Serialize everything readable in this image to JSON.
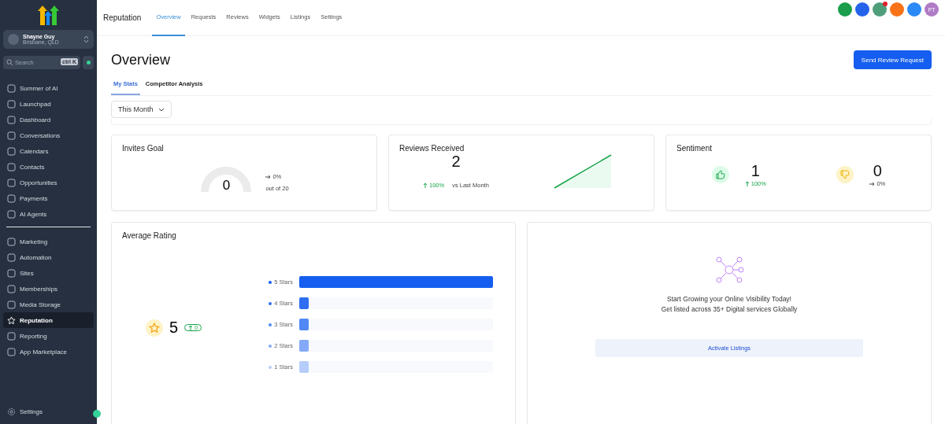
{
  "sidebar": {
    "account": {
      "name": "Shayne Guy",
      "location": "Brisbane, QLD"
    },
    "search": {
      "placeholder": "Search",
      "shortcut": "ctrl K"
    },
    "items": [
      {
        "label": "Summer of AI",
        "selected": false
      },
      {
        "label": "Launchpad",
        "selected": false
      },
      {
        "label": "Dashboard",
        "selected": false
      },
      {
        "label": "Conversations",
        "selected": false
      },
      {
        "label": "Calendars",
        "selected": false
      },
      {
        "label": "Contacts",
        "selected": false
      },
      {
        "label": "Opportunities",
        "selected": false
      },
      {
        "label": "Payments",
        "selected": false
      },
      {
        "label": "AI Agents",
        "selected": false
      }
    ],
    "items2": [
      {
        "label": "Marketing",
        "selected": false
      },
      {
        "label": "Automation",
        "selected": false
      },
      {
        "label": "Sites",
        "selected": false
      },
      {
        "label": "Memberships",
        "selected": false
      },
      {
        "label": "Media Storage",
        "selected": false
      },
      {
        "label": "Reputation",
        "selected": true
      },
      {
        "label": "Reporting",
        "selected": false
      },
      {
        "label": "App Marketplace",
        "selected": false
      }
    ],
    "settings": "Settings"
  },
  "topbar": {
    "title": "Reputation",
    "tabs": [
      {
        "label": "Overview",
        "selected": true
      },
      {
        "label": "Requests",
        "selected": false
      },
      {
        "label": "Reviews",
        "selected": false
      },
      {
        "label": "Widgets",
        "selected": false
      },
      {
        "label": "Listings",
        "selected": false
      },
      {
        "label": "Settings",
        "selected": false
      }
    ],
    "avatar": "PT",
    "notification_dot": true
  },
  "page": {
    "title": "Overview",
    "primary_button": "Send Review Request",
    "subtabs": [
      {
        "label": "My Stats",
        "selected": true
      },
      {
        "label": "Competitor Analysis",
        "selected": false
      }
    ],
    "period": "This Month"
  },
  "invites_goal": {
    "title": "Invites Goal",
    "value": "0",
    "change": "0%",
    "target": "out of 20"
  },
  "reviews_received": {
    "title": "Reviews Received",
    "value": "2",
    "change": "100%",
    "comparison": "vs Last Month"
  },
  "sentiment": {
    "title": "Sentiment",
    "positive": {
      "value": "1",
      "change": "100%"
    },
    "negative": {
      "value": "0",
      "change": "0%"
    }
  },
  "average_rating": {
    "title": "Average Rating",
    "value": "5",
    "change": "0",
    "rows": [
      {
        "label": "5 Stars",
        "level": 1,
        "color": "#155eef"
      },
      {
        "label": "4 Stars",
        "level": 0.05,
        "color": "#2e6ff2"
      },
      {
        "label": "3 Stars",
        "level": 0.05,
        "color": "#5288f5"
      },
      {
        "label": "2 Stars",
        "level": 0.05,
        "color": "#84a9f8"
      },
      {
        "label": "1 Stars",
        "level": 0.05,
        "color": "#b6cdfb"
      }
    ]
  },
  "listings": {
    "heading": "Start Growing your Online Visibility Today!",
    "subheading": "Get listed across 35+ Digital services Globally",
    "button": "Activate Listings"
  }
}
